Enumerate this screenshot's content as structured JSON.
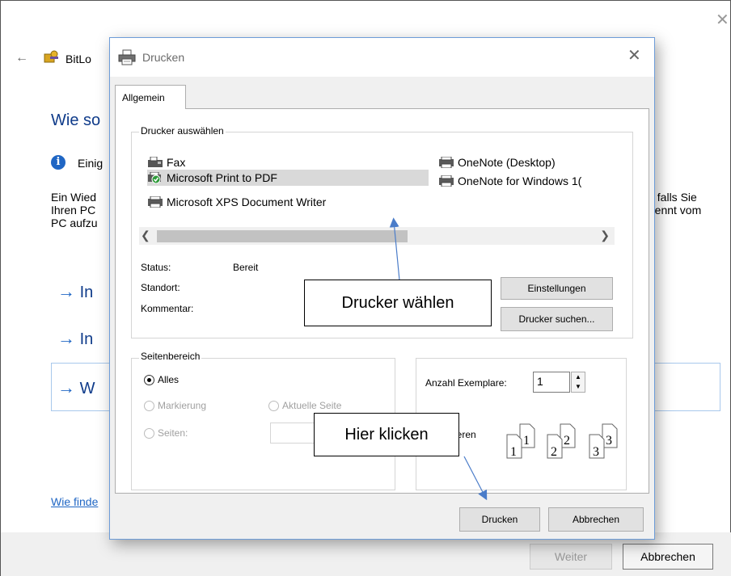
{
  "background_window": {
    "app_title": "BitLo",
    "heading": "Wie so",
    "info_text": "Einig",
    "body_lines_left": [
      "Ein Wied",
      "Ihren PC",
      "PC aufzu"
    ],
    "body_lines_right": [
      ", falls Sie",
      "rennt vom"
    ],
    "options": [
      "In",
      "In",
      "W"
    ],
    "help_link": "Wie finde",
    "buttons": {
      "next": "Weiter",
      "cancel": "Abbrechen"
    }
  },
  "dialog": {
    "title": "Drucken",
    "tab": "Allgemein",
    "printer_group": {
      "legend": "Drucker auswählen",
      "printers": [
        {
          "name": "Fax",
          "icon": "fax-icon"
        },
        {
          "name": "Microsoft Print to PDF",
          "icon": "default-printer-icon",
          "selected": true
        },
        {
          "name": "Microsoft XPS Document Writer",
          "icon": "printer-icon"
        },
        {
          "name": "OneNote (Desktop)",
          "icon": "printer-icon"
        },
        {
          "name": "OneNote for Windows 1(",
          "icon": "printer-icon"
        }
      ],
      "status_label": "Status:",
      "status_value": "Bereit",
      "location_label": "Standort:",
      "comment_label": "Kommentar:",
      "settings_button": "Einstellungen",
      "find_button": "Drucker suchen..."
    },
    "page_range": {
      "legend": "Seitenbereich",
      "all": "Alles",
      "selection": "Markierung",
      "current_page": "Aktuelle Seite",
      "pages": "Seiten:"
    },
    "copies": {
      "label": "Anzahl Exemplare:",
      "value": "1",
      "collate_label": "ieren",
      "collate_pages": [
        "1",
        "2",
        "3"
      ]
    },
    "buttons": {
      "print": "Drucken",
      "cancel": "Abbrechen"
    }
  },
  "callouts": {
    "choose_printer": "Drucker wählen",
    "click_here": "Hier klicken"
  },
  "colors": {
    "accent_blue": "#1f66c4",
    "heading_blue": "#0f3b8a",
    "selection_gray": "#d9d9d9",
    "arrow_blue": "#4a7cc9"
  }
}
